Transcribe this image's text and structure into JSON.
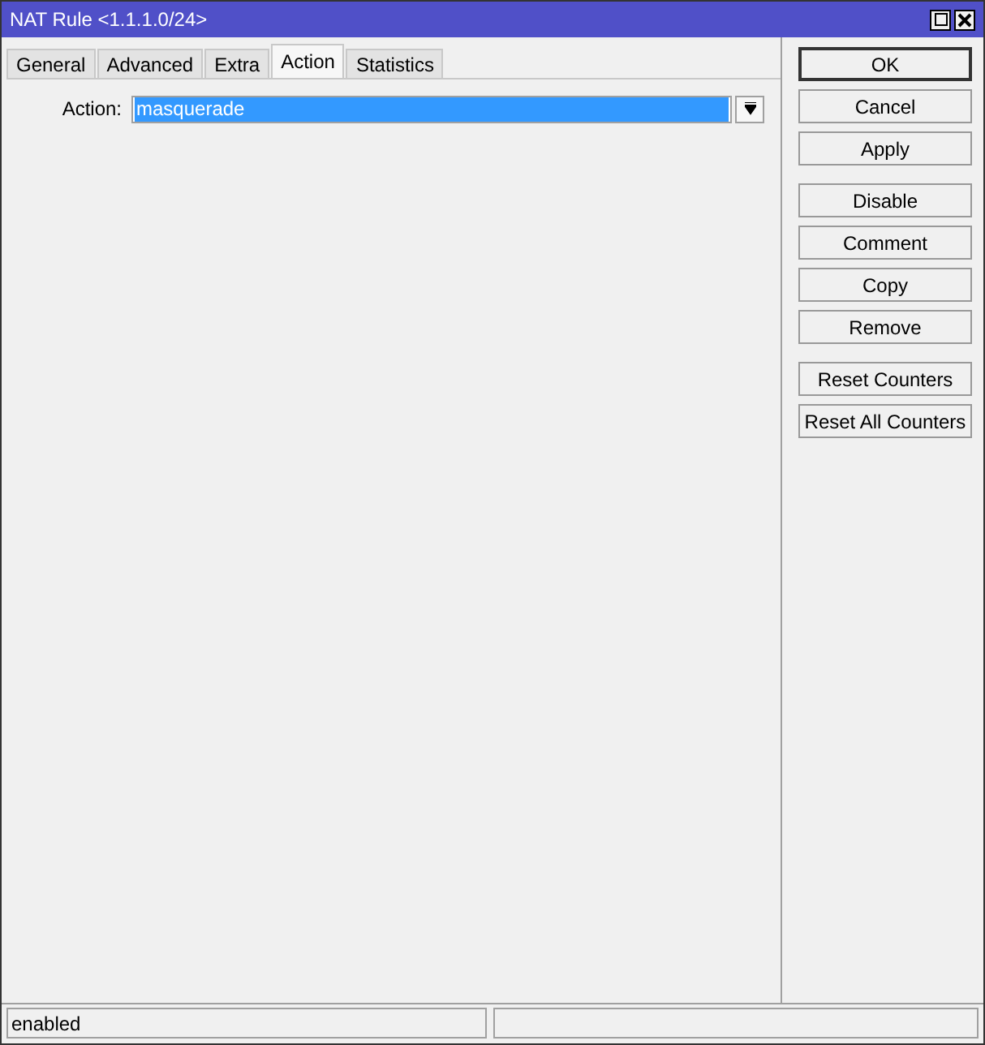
{
  "window": {
    "title": "NAT Rule <1.1.1.0/24>"
  },
  "tabs": [
    {
      "label": "General",
      "selected": false
    },
    {
      "label": "Advanced",
      "selected": false
    },
    {
      "label": "Extra",
      "selected": false
    },
    {
      "label": "Action",
      "selected": true
    },
    {
      "label": "Statistics",
      "selected": false
    }
  ],
  "fields": [
    {
      "label": "Action:",
      "value": "masquerade",
      "highlighted": true
    }
  ],
  "button_groups": [
    {
      "buttons": [
        {
          "label": "OK",
          "default": true
        },
        {
          "label": "Cancel",
          "default": false
        },
        {
          "label": "Apply",
          "default": false
        }
      ]
    },
    {
      "buttons": [
        {
          "label": "Disable",
          "default": false
        },
        {
          "label": "Comment",
          "default": false
        },
        {
          "label": "Copy",
          "default": false
        },
        {
          "label": "Remove",
          "default": false
        }
      ]
    },
    {
      "buttons": [
        {
          "label": "Reset Counters",
          "default": false
        },
        {
          "label": "Reset All Counters",
          "default": false
        }
      ]
    }
  ],
  "status_bar": {
    "text": "enabled"
  }
}
